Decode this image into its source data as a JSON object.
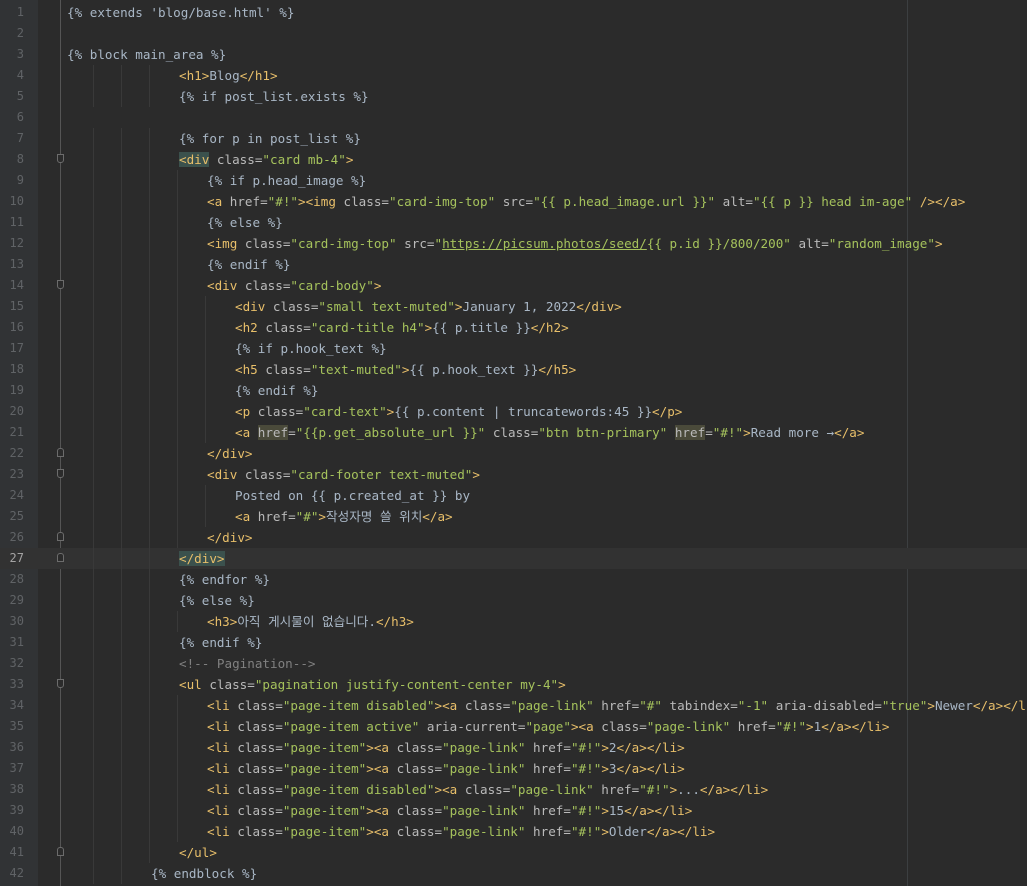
{
  "editor": {
    "current_line": 27,
    "lines": [
      {
        "n": "1",
        "indent": 0,
        "segs": [
          [
            "tpl",
            "{% extends 'blog/base.html' %}"
          ]
        ]
      },
      {
        "n": "2",
        "indent": 0,
        "segs": []
      },
      {
        "n": "3",
        "indent": 0,
        "segs": [
          [
            "tpl",
            "{% block main_area %}"
          ]
        ]
      },
      {
        "n": "4",
        "indent": 16,
        "segs": [
          [
            "tag",
            "<h1>"
          ],
          [
            "txt",
            "Blog"
          ],
          [
            "tag",
            "</h1>"
          ]
        ]
      },
      {
        "n": "5",
        "indent": 16,
        "segs": [
          [
            "tpl",
            "{% if post_list.exists %}"
          ]
        ]
      },
      {
        "n": "6",
        "indent": 0,
        "segs": []
      },
      {
        "n": "7",
        "indent": 16,
        "segs": [
          [
            "tpl",
            "{% for p in post_list %}"
          ]
        ]
      },
      {
        "n": "8",
        "indent": 16,
        "fold": "start",
        "segs": [
          [
            "tag hl",
            "<div"
          ],
          [
            "attr",
            " class="
          ],
          [
            "str",
            "\"card mb-4\""
          ],
          [
            "tag",
            ">"
          ]
        ]
      },
      {
        "n": "9",
        "indent": 20,
        "segs": [
          [
            "tpl",
            "{% if p.head_image %}"
          ]
        ]
      },
      {
        "n": "10",
        "indent": 20,
        "segs": [
          [
            "tag",
            "<a"
          ],
          [
            "attr",
            " href="
          ],
          [
            "str",
            "\"#!\""
          ],
          [
            "tag",
            "><img"
          ],
          [
            "attr",
            " class="
          ],
          [
            "str",
            "\"card-img-top\""
          ],
          [
            "attr",
            " src="
          ],
          [
            "str",
            "\"{{ p.head_image.url }}\""
          ],
          [
            "attr",
            " alt="
          ],
          [
            "str",
            "\"{{ p }} head im-age\""
          ],
          [
            "tag",
            " /></a>"
          ]
        ]
      },
      {
        "n": "11",
        "indent": 20,
        "segs": [
          [
            "tpl",
            "{% else %}"
          ]
        ]
      },
      {
        "n": "12",
        "indent": 20,
        "segs": [
          [
            "tag",
            "<img"
          ],
          [
            "attr",
            " class="
          ],
          [
            "str",
            "\"card-img-top\""
          ],
          [
            "attr",
            " src="
          ],
          [
            "str",
            "\""
          ],
          [
            "url",
            "https://picsum.photos/seed/"
          ],
          [
            "str",
            "{{ p.id }}/800/200\""
          ],
          [
            "attr",
            " alt="
          ],
          [
            "str",
            "\"random_image\""
          ],
          [
            "tag",
            ">"
          ]
        ]
      },
      {
        "n": "13",
        "indent": 20,
        "segs": [
          [
            "tpl",
            "{% endif %}"
          ]
        ]
      },
      {
        "n": "14",
        "indent": 20,
        "fold": "start",
        "segs": [
          [
            "tag",
            "<div"
          ],
          [
            "attr",
            " class="
          ],
          [
            "str",
            "\"card-body\""
          ],
          [
            "tag",
            ">"
          ]
        ]
      },
      {
        "n": "15",
        "indent": 24,
        "segs": [
          [
            "tag",
            "<div"
          ],
          [
            "attr",
            " class="
          ],
          [
            "str",
            "\"small text-muted\""
          ],
          [
            "tag",
            ">"
          ],
          [
            "txt",
            "January 1, 2022"
          ],
          [
            "tag",
            "</div>"
          ]
        ]
      },
      {
        "n": "16",
        "indent": 24,
        "segs": [
          [
            "tag",
            "<h2"
          ],
          [
            "attr",
            " class="
          ],
          [
            "str",
            "\"card-title h4\""
          ],
          [
            "tag",
            ">"
          ],
          [
            "txt",
            "{{ p.title }}"
          ],
          [
            "tag",
            "</h2>"
          ]
        ]
      },
      {
        "n": "17",
        "indent": 24,
        "segs": [
          [
            "tpl",
            "{% if p.hook_text %}"
          ]
        ]
      },
      {
        "n": "18",
        "indent": 24,
        "segs": [
          [
            "tag",
            "<h5"
          ],
          [
            "attr",
            " class="
          ],
          [
            "str",
            "\"text-muted\""
          ],
          [
            "tag",
            ">"
          ],
          [
            "txt",
            "{{ p.hook_text }}"
          ],
          [
            "tag",
            "</h5>"
          ]
        ]
      },
      {
        "n": "19",
        "indent": 24,
        "segs": [
          [
            "tpl",
            "{% endif %}"
          ]
        ]
      },
      {
        "n": "20",
        "indent": 24,
        "segs": [
          [
            "tag",
            "<p"
          ],
          [
            "attr",
            " class="
          ],
          [
            "str",
            "\"card-text\""
          ],
          [
            "tag",
            ">"
          ],
          [
            "txt",
            "{{ p.content | truncatewords:45 }}"
          ],
          [
            "tag",
            "</p>"
          ]
        ]
      },
      {
        "n": "21",
        "indent": 24,
        "segs": [
          [
            "tag",
            "<a"
          ],
          [
            "txt",
            " "
          ],
          [
            "attr hl-attr",
            "href"
          ],
          [
            "attr",
            "="
          ],
          [
            "str",
            "\"{{p.get_absolute_url }}\""
          ],
          [
            "attr",
            " class="
          ],
          [
            "str",
            "\"btn btn-primary\""
          ],
          [
            "txt",
            " "
          ],
          [
            "attr hl-attr",
            "href"
          ],
          [
            "attr",
            "="
          ],
          [
            "str",
            "\"#!\""
          ],
          [
            "tag",
            ">"
          ],
          [
            "txt",
            "Read more →"
          ],
          [
            "tag",
            "</a>"
          ]
        ]
      },
      {
        "n": "22",
        "indent": 20,
        "fold": "end",
        "segs": [
          [
            "tag",
            "</div>"
          ]
        ]
      },
      {
        "n": "23",
        "indent": 20,
        "fold": "start",
        "segs": [
          [
            "tag",
            "<div"
          ],
          [
            "attr",
            " class="
          ],
          [
            "str",
            "\"card-footer text-muted\""
          ],
          [
            "tag",
            ">"
          ]
        ]
      },
      {
        "n": "24",
        "indent": 24,
        "segs": [
          [
            "txt",
            "Posted on {{ p.created_at }} by"
          ]
        ]
      },
      {
        "n": "25",
        "indent": 24,
        "segs": [
          [
            "tag",
            "<a"
          ],
          [
            "attr",
            " href="
          ],
          [
            "str",
            "\"#\""
          ],
          [
            "tag",
            ">"
          ],
          [
            "txt",
            "작성자명 쓸 위치"
          ],
          [
            "tag",
            "</a>"
          ]
        ]
      },
      {
        "n": "26",
        "indent": 20,
        "fold": "end",
        "segs": [
          [
            "tag",
            "</div>"
          ]
        ]
      },
      {
        "n": "27",
        "indent": 16,
        "fold": "end",
        "segs": [
          [
            "tag hl",
            "</div>"
          ]
        ]
      },
      {
        "n": "28",
        "indent": 16,
        "segs": [
          [
            "tpl",
            "{% endfor %}"
          ]
        ]
      },
      {
        "n": "29",
        "indent": 16,
        "segs": [
          [
            "tpl",
            "{% else %}"
          ]
        ]
      },
      {
        "n": "30",
        "indent": 20,
        "segs": [
          [
            "tag",
            "<h3>"
          ],
          [
            "txt",
            "아직 게시물이 없습니다."
          ],
          [
            "tag",
            "</h3>"
          ]
        ]
      },
      {
        "n": "31",
        "indent": 16,
        "segs": [
          [
            "tpl",
            "{% endif %}"
          ]
        ]
      },
      {
        "n": "32",
        "indent": 16,
        "segs": [
          [
            "cmt",
            "<!-- Pagination-->"
          ]
        ]
      },
      {
        "n": "33",
        "indent": 16,
        "fold": "start",
        "segs": [
          [
            "tag",
            "<ul"
          ],
          [
            "attr",
            " class="
          ],
          [
            "str",
            "\"pagination justify-content-center my-4\""
          ],
          [
            "tag",
            ">"
          ]
        ]
      },
      {
        "n": "34",
        "indent": 20,
        "segs": [
          [
            "tag",
            "<li"
          ],
          [
            "attr",
            " class="
          ],
          [
            "str",
            "\"page-item disabled\""
          ],
          [
            "tag",
            "><a"
          ],
          [
            "attr",
            " class="
          ],
          [
            "str",
            "\"page-link\""
          ],
          [
            "attr",
            " href="
          ],
          [
            "str",
            "\"#\""
          ],
          [
            "attr",
            " tabindex="
          ],
          [
            "str",
            "\"-1\""
          ],
          [
            "attr",
            " aria-disabled="
          ],
          [
            "str",
            "\"true\""
          ],
          [
            "tag",
            ">"
          ],
          [
            "txt",
            "Newer"
          ],
          [
            "tag",
            "</a></li>"
          ]
        ]
      },
      {
        "n": "35",
        "indent": 20,
        "segs": [
          [
            "tag",
            "<li"
          ],
          [
            "attr",
            " class="
          ],
          [
            "str",
            "\"page-item active\""
          ],
          [
            "attr",
            " aria-current="
          ],
          [
            "str",
            "\"page\""
          ],
          [
            "tag",
            "><a"
          ],
          [
            "attr",
            " class="
          ],
          [
            "str",
            "\"page-link\""
          ],
          [
            "attr",
            " href="
          ],
          [
            "str",
            "\"#!\""
          ],
          [
            "tag",
            ">"
          ],
          [
            "txt",
            "1"
          ],
          [
            "tag",
            "</a></li>"
          ]
        ]
      },
      {
        "n": "36",
        "indent": 20,
        "segs": [
          [
            "tag",
            "<li"
          ],
          [
            "attr",
            " class="
          ],
          [
            "str",
            "\"page-item\""
          ],
          [
            "tag",
            "><a"
          ],
          [
            "attr",
            " class="
          ],
          [
            "str",
            "\"page-link\""
          ],
          [
            "attr",
            " href="
          ],
          [
            "str",
            "\"#!\""
          ],
          [
            "tag",
            ">"
          ],
          [
            "txt",
            "2"
          ],
          [
            "tag",
            "</a></li>"
          ]
        ]
      },
      {
        "n": "37",
        "indent": 20,
        "segs": [
          [
            "tag",
            "<li"
          ],
          [
            "attr",
            " class="
          ],
          [
            "str",
            "\"page-item\""
          ],
          [
            "tag",
            "><a"
          ],
          [
            "attr",
            " class="
          ],
          [
            "str",
            "\"page-link\""
          ],
          [
            "attr",
            " href="
          ],
          [
            "str",
            "\"#!\""
          ],
          [
            "tag",
            ">"
          ],
          [
            "txt",
            "3"
          ],
          [
            "tag",
            "</a></li>"
          ]
        ]
      },
      {
        "n": "38",
        "indent": 20,
        "segs": [
          [
            "tag",
            "<li"
          ],
          [
            "attr",
            " class="
          ],
          [
            "str",
            "\"page-item disabled\""
          ],
          [
            "tag",
            "><a"
          ],
          [
            "attr",
            " class="
          ],
          [
            "str",
            "\"page-link\""
          ],
          [
            "attr",
            " href="
          ],
          [
            "str",
            "\"#!\""
          ],
          [
            "tag",
            ">"
          ],
          [
            "txt",
            "..."
          ],
          [
            "tag",
            "</a></li>"
          ]
        ]
      },
      {
        "n": "39",
        "indent": 20,
        "segs": [
          [
            "tag",
            "<li"
          ],
          [
            "attr",
            " class="
          ],
          [
            "str",
            "\"page-item\""
          ],
          [
            "tag",
            "><a"
          ],
          [
            "attr",
            " class="
          ],
          [
            "str",
            "\"page-link\""
          ],
          [
            "attr",
            " href="
          ],
          [
            "str",
            "\"#!\""
          ],
          [
            "tag",
            ">"
          ],
          [
            "txt",
            "15"
          ],
          [
            "tag",
            "</a></li>"
          ]
        ]
      },
      {
        "n": "40",
        "indent": 20,
        "segs": [
          [
            "tag",
            "<li"
          ],
          [
            "attr",
            " class="
          ],
          [
            "str",
            "\"page-item\""
          ],
          [
            "tag",
            "><a"
          ],
          [
            "attr",
            " class="
          ],
          [
            "str",
            "\"page-link\""
          ],
          [
            "attr",
            " href="
          ],
          [
            "str",
            "\"#!\""
          ],
          [
            "tag",
            ">"
          ],
          [
            "txt",
            "Older"
          ],
          [
            "tag",
            "</a></li>"
          ]
        ]
      },
      {
        "n": "41",
        "indent": 16,
        "fold": "end",
        "segs": [
          [
            "tag",
            "</ul>"
          ]
        ]
      },
      {
        "n": "42",
        "indent": 12,
        "segs": [
          [
            "tpl",
            "{% endblock %}"
          ]
        ]
      }
    ]
  }
}
